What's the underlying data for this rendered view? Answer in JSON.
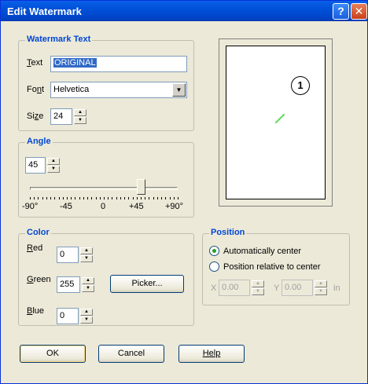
{
  "window": {
    "title": "Edit Watermark",
    "help_glyph": "?",
    "close_glyph": "✕"
  },
  "watermark_text": {
    "group_label": "Watermark Text",
    "text_label": "Text",
    "text_value": "ORIGINAL",
    "font_label": "Font",
    "font_value": "Helvetica",
    "size_label": "Size",
    "size_value": "24"
  },
  "angle": {
    "group_label": "Angle",
    "value": "45",
    "tick_labels": [
      "-90°",
      "-45",
      "0",
      "+45",
      "+90°"
    ],
    "slider_level": 45,
    "slider_range": [
      -90,
      90
    ]
  },
  "color": {
    "group_label": "Color",
    "red_label": "Red",
    "red_value": "0",
    "green_label": "Green",
    "green_value": "255",
    "blue_label": "Blue",
    "blue_value": "0",
    "picker_label": "Picker..."
  },
  "position": {
    "group_label": "Position",
    "auto_center_label": "Automatically center",
    "relative_label": "Position relative to center",
    "x_label": "X",
    "x_value": "0.00",
    "y_label": "Y",
    "y_value": "0.00",
    "unit": "in"
  },
  "preview": {
    "badge": "1"
  },
  "buttons": {
    "ok": "OK",
    "cancel": "Cancel",
    "help": "Help"
  },
  "colors": {
    "accent": "#0046d5",
    "watermark": "#5cd85c",
    "selection": "#316ac5"
  }
}
